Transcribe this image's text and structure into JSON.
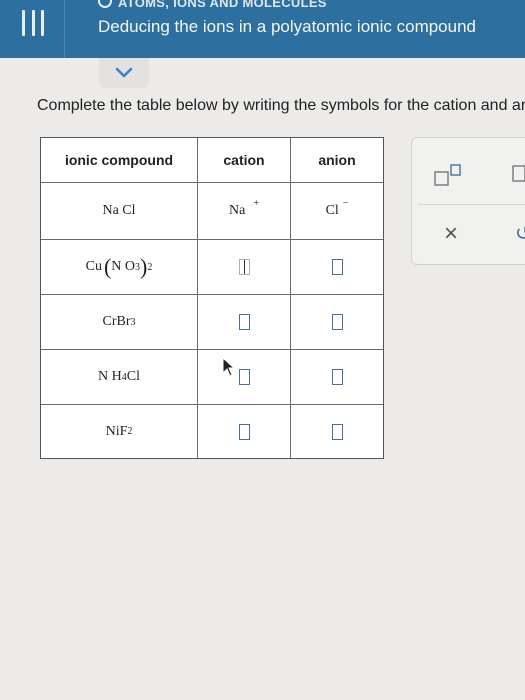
{
  "header": {
    "breadcrumb": "ATOMS, IONS AND MOLECULES",
    "title": "Deducing the ions in a polyatomic ionic compound"
  },
  "instruction": "Complete the table below by writing the symbols for the cation and anion",
  "table": {
    "headers": [
      "ionic compound",
      "cation",
      "anion"
    ],
    "rows": [
      {
        "compound": "NaCl",
        "cation": "Na⁺",
        "anion": "Cl⁻"
      },
      {
        "compound": "Cu(NO3)2",
        "cation": "",
        "anion": ""
      },
      {
        "compound": "CrBr3",
        "cation": "",
        "anion": ""
      },
      {
        "compound": "NH4Cl",
        "cation": "",
        "anion": ""
      },
      {
        "compound": "NiF2",
        "cation": "",
        "anion": ""
      }
    ]
  },
  "labels": {
    "na": "Na",
    "na_charge": "+",
    "cl": "Cl",
    "cl_charge": "−",
    "cu": "Cu",
    "no": "N O",
    "no_sub": "3",
    "cu_sub": "2",
    "cr": "CrBr",
    "cr_sub": "3",
    "nh": "N H",
    "nh_sub": "4",
    "nh_cl": "Cl",
    "ni": "NiF",
    "ni_sub": "2",
    "nacl": "Na Cl"
  },
  "palette": {
    "close_symbol": "×",
    "undo_symbol": "↺"
  },
  "colors": {
    "header_bg": "#2d6f9e",
    "box_border": "#4a6f9a"
  }
}
